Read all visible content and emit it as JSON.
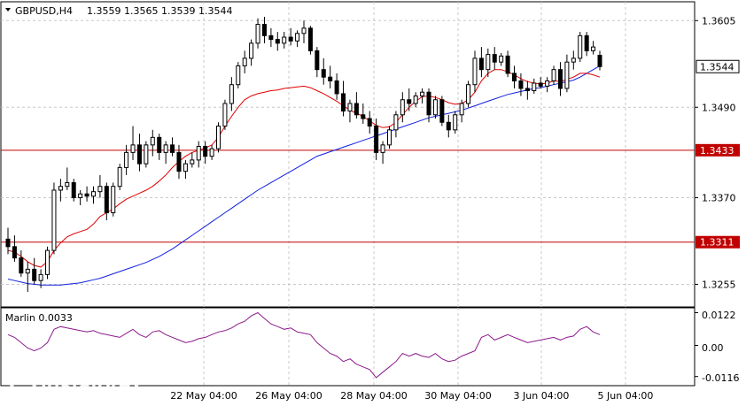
{
  "header": {
    "symbol": "GBPUSD,H4",
    "ohlc": "1.3559 1.3565 1.3539 1.3544"
  },
  "indicator": {
    "label": "Marlin 0.0033",
    "ticks": [
      "0.0122",
      "0.00",
      "-0.0116"
    ]
  },
  "watermark": {
    "brand": "instaforex",
    "tagline": "Instant Forex Trading"
  },
  "colors": {
    "background": "#ffffff",
    "grid": "#c8c8c8",
    "level": "#c00000",
    "ma_fast": "#e00000",
    "ma_slow": "#1020e0",
    "marlin": "#8b1a8b",
    "candle": "#000000",
    "current_box": "#000000"
  },
  "chart_data": {
    "type": "candlestick",
    "timeframe": "H4",
    "price_ticks": [
      "1.3605",
      "1.3490",
      "1.3370",
      "1.3255"
    ],
    "x_ticks": [
      "22 May 04:00",
      "26 May 04:00",
      "28 May 04:00",
      "30 May 04:00",
      "3 Jun 04:00",
      "5 Jun 04:00"
    ],
    "ylim": [
      1.3225,
      1.363
    ],
    "levels": [
      {
        "value": 1.3433,
        "label": "1.3433"
      },
      {
        "value": 1.3311,
        "label": "1.3311"
      }
    ],
    "current_price": {
      "value": 1.3544,
      "label": "1.3544"
    },
    "candles": [
      [
        1.3315,
        1.333,
        1.3295,
        1.3305
      ],
      [
        1.3305,
        1.332,
        1.3285,
        1.329
      ],
      [
        1.329,
        1.33,
        1.3265,
        1.327
      ],
      [
        1.327,
        1.3285,
        1.3245,
        1.3275
      ],
      [
        1.3275,
        1.329,
        1.3255,
        1.326
      ],
      [
        1.326,
        1.3275,
        1.325,
        1.3268
      ],
      [
        1.3268,
        1.3305,
        1.3262,
        1.33
      ],
      [
        1.33,
        1.339,
        1.3295,
        1.338
      ],
      [
        1.338,
        1.3395,
        1.3365,
        1.3385
      ],
      [
        1.3385,
        1.341,
        1.338,
        1.339
      ],
      [
        1.339,
        1.3395,
        1.3365,
        1.337
      ],
      [
        1.337,
        1.338,
        1.336,
        1.3375
      ],
      [
        1.3375,
        1.3385,
        1.3365,
        1.3372
      ],
      [
        1.3372,
        1.3385,
        1.3362,
        1.3378
      ],
      [
        1.3378,
        1.34,
        1.337,
        1.3385
      ],
      [
        1.3385,
        1.339,
        1.334,
        1.335
      ],
      [
        1.335,
        1.339,
        1.3345,
        1.3385
      ],
      [
        1.3385,
        1.3415,
        1.338,
        1.341
      ],
      [
        1.341,
        1.344,
        1.34,
        1.343
      ],
      [
        1.343,
        1.3465,
        1.342,
        1.344
      ],
      [
        1.344,
        1.3455,
        1.3405,
        1.3415
      ],
      [
        1.3415,
        1.3445,
        1.341,
        1.344
      ],
      [
        1.344,
        1.346,
        1.3425,
        1.345
      ],
      [
        1.345,
        1.3455,
        1.342,
        1.343
      ],
      [
        1.343,
        1.3445,
        1.3415,
        1.344
      ],
      [
        1.344,
        1.345,
        1.3425,
        1.343
      ],
      [
        1.343,
        1.344,
        1.3395,
        1.3405
      ],
      [
        1.3405,
        1.342,
        1.3395,
        1.3415
      ],
      [
        1.3415,
        1.343,
        1.341,
        1.342
      ],
      [
        1.342,
        1.3445,
        1.341,
        1.3438
      ],
      [
        1.3438,
        1.3445,
        1.3415,
        1.3425
      ],
      [
        1.3425,
        1.344,
        1.342,
        1.3435
      ],
      [
        1.3435,
        1.347,
        1.343,
        1.3465
      ],
      [
        1.3465,
        1.35,
        1.346,
        1.3495
      ],
      [
        1.3495,
        1.353,
        1.3485,
        1.352
      ],
      [
        1.352,
        1.355,
        1.3515,
        1.3545
      ],
      [
        1.3545,
        1.3565,
        1.3535,
        1.3555
      ],
      [
        1.3555,
        1.358,
        1.3545,
        1.3575
      ],
      [
        1.3575,
        1.3608,
        1.3568,
        1.36
      ],
      [
        1.36,
        1.361,
        1.3575,
        1.3585
      ],
      [
        1.3585,
        1.3595,
        1.357,
        1.358
      ],
      [
        1.358,
        1.359,
        1.3565,
        1.3575
      ],
      [
        1.3575,
        1.359,
        1.3568,
        1.3583
      ],
      [
        1.3583,
        1.3595,
        1.3572,
        1.3578
      ],
      [
        1.3578,
        1.3592,
        1.357,
        1.3588
      ],
      [
        1.3588,
        1.3605,
        1.3575,
        1.3595
      ],
      [
        1.3595,
        1.3598,
        1.356,
        1.3565
      ],
      [
        1.3565,
        1.357,
        1.353,
        1.354
      ],
      [
        1.354,
        1.3555,
        1.352,
        1.353
      ],
      [
        1.353,
        1.3545,
        1.3515,
        1.3525
      ],
      [
        1.3525,
        1.3535,
        1.35,
        1.3508
      ],
      [
        1.3508,
        1.3525,
        1.3478,
        1.3485
      ],
      [
        1.3485,
        1.35,
        1.347,
        1.3495
      ],
      [
        1.3495,
        1.351,
        1.3475,
        1.348
      ],
      [
        1.348,
        1.3495,
        1.3468,
        1.3475
      ],
      [
        1.3475,
        1.3485,
        1.3455,
        1.3465
      ],
      [
        1.3465,
        1.3475,
        1.342,
        1.343
      ],
      [
        1.343,
        1.3445,
        1.3415,
        1.344
      ],
      [
        1.344,
        1.3465,
        1.3435,
        1.346
      ],
      [
        1.346,
        1.3485,
        1.345,
        1.348
      ],
      [
        1.348,
        1.351,
        1.347,
        1.35
      ],
      [
        1.35,
        1.3515,
        1.3485,
        1.3495
      ],
      [
        1.3495,
        1.351,
        1.349,
        1.3505
      ],
      [
        1.3505,
        1.3515,
        1.3495,
        1.351
      ],
      [
        1.351,
        1.3515,
        1.347,
        1.348
      ],
      [
        1.348,
        1.3505,
        1.3475,
        1.35
      ],
      [
        1.35,
        1.3505,
        1.3465,
        1.347
      ],
      [
        1.347,
        1.348,
        1.345,
        1.346
      ],
      [
        1.346,
        1.3485,
        1.3455,
        1.348
      ],
      [
        1.348,
        1.35,
        1.347,
        1.3495
      ],
      [
        1.3495,
        1.3525,
        1.349,
        1.352
      ],
      [
        1.352,
        1.3565,
        1.351,
        1.3555
      ],
      [
        1.3555,
        1.357,
        1.353,
        1.354
      ],
      [
        1.354,
        1.3568,
        1.353,
        1.356
      ],
      [
        1.356,
        1.357,
        1.354,
        1.355
      ],
      [
        1.355,
        1.3562,
        1.3545,
        1.3558
      ],
      [
        1.3558,
        1.3565,
        1.353,
        1.3535
      ],
      [
        1.3535,
        1.3545,
        1.3515,
        1.3525
      ],
      [
        1.3525,
        1.3535,
        1.3505,
        1.3515
      ],
      [
        1.3515,
        1.3525,
        1.35,
        1.3512
      ],
      [
        1.3512,
        1.3528,
        1.3508,
        1.3522
      ],
      [
        1.3522,
        1.353,
        1.3515,
        1.3518
      ],
      [
        1.3518,
        1.353,
        1.351,
        1.3525
      ],
      [
        1.3525,
        1.3545,
        1.352,
        1.354
      ],
      [
        1.354,
        1.355,
        1.3505,
        1.3515
      ],
      [
        1.3515,
        1.356,
        1.351,
        1.355
      ],
      [
        1.355,
        1.3565,
        1.354,
        1.3555
      ],
      [
        1.3555,
        1.359,
        1.355,
        1.3585
      ],
      [
        1.3585,
        1.359,
        1.3558,
        1.3565
      ],
      [
        1.3565,
        1.3578,
        1.356,
        1.357
      ],
      [
        1.3559,
        1.3565,
        1.3539,
        1.3544
      ]
    ],
    "ma_fast": [
      1.33,
      1.3298,
      1.3292,
      1.3285,
      1.328,
      1.3278,
      1.3285,
      1.33,
      1.331,
      1.3318,
      1.3322,
      1.3325,
      1.3328,
      1.3335,
      1.3345,
      1.335,
      1.3355,
      1.3362,
      1.3368,
      1.3372,
      1.3376,
      1.338,
      1.3385,
      1.3392,
      1.34,
      1.341,
      1.3418,
      1.3425,
      1.343,
      1.3433,
      1.3436,
      1.344,
      1.345,
      1.3465,
      1.3478,
      1.349,
      1.35,
      1.3505,
      1.3508,
      1.351,
      1.3512,
      1.3513,
      1.3515,
      1.3516,
      1.3517,
      1.3518,
      1.3516,
      1.3512,
      1.3508,
      1.3503,
      1.3498,
      1.3492,
      1.3486,
      1.3482,
      1.3478,
      1.3472,
      1.3466,
      1.3463,
      1.3464,
      1.347,
      1.348,
      1.349,
      1.3498,
      1.3504,
      1.3505,
      1.3503,
      1.35,
      1.3496,
      1.3494,
      1.3495,
      1.35,
      1.351,
      1.3525,
      1.3535,
      1.354,
      1.354,
      1.3537,
      1.3533,
      1.3528,
      1.3524,
      1.3522,
      1.3521,
      1.3522,
      1.3525,
      1.3524,
      1.3527,
      1.353,
      1.3535,
      1.3535,
      1.3533,
      1.353
    ],
    "ma_slow": [
      1.3262,
      1.326,
      1.3258,
      1.3256,
      1.3255,
      1.3254,
      1.3254,
      1.3254,
      1.3254,
      1.3255,
      1.3256,
      1.3257,
      1.3259,
      1.3261,
      1.3263,
      1.3266,
      1.3269,
      1.3272,
      1.3275,
      1.3278,
      1.3281,
      1.3284,
      1.3288,
      1.3292,
      1.3297,
      1.3302,
      1.3308,
      1.3314,
      1.332,
      1.3326,
      1.3332,
      1.3338,
      1.3344,
      1.335,
      1.3356,
      1.3362,
      1.3368,
      1.3374,
      1.338,
      1.3385,
      1.339,
      1.3395,
      1.34,
      1.3405,
      1.341,
      1.3415,
      1.342,
      1.3425,
      1.3428,
      1.3431,
      1.3434,
      1.3437,
      1.344,
      1.3443,
      1.3446,
      1.3449,
      1.3452,
      1.3455,
      1.3458,
      1.3461,
      1.3464,
      1.3467,
      1.347,
      1.3473,
      1.3476,
      1.3478,
      1.348,
      1.3482,
      1.3484,
      1.3486,
      1.3489,
      1.3492,
      1.3495,
      1.3498,
      1.3501,
      1.3504,
      1.3507,
      1.3509,
      1.3511,
      1.3513,
      1.3515,
      1.3516,
      1.3518,
      1.352,
      1.3522,
      1.3524,
      1.3526,
      1.353,
      1.3535,
      1.354,
      1.3545
    ],
    "marlin": {
      "ylim": [
        -0.015,
        0.014
      ],
      "values": [
        0.004,
        0.003,
        0.001,
        -0.001,
        -0.002,
        -0.001,
        0.001,
        0.006,
        0.007,
        0.0065,
        0.006,
        0.0055,
        0.005,
        0.0055,
        0.0045,
        0.004,
        0.0035,
        0.003,
        0.0045,
        0.006,
        0.004,
        0.003,
        0.005,
        0.0055,
        0.004,
        0.003,
        0.002,
        0.001,
        0.0015,
        0.0025,
        0.003,
        0.004,
        0.005,
        0.0055,
        0.0065,
        0.008,
        0.009,
        0.011,
        0.0122,
        0.01,
        0.008,
        0.007,
        0.006,
        0.0065,
        0.005,
        0.0045,
        0.004,
        0.001,
        -0.001,
        -0.003,
        -0.004,
        -0.006,
        -0.005,
        -0.007,
        -0.008,
        -0.009,
        -0.012,
        -0.01,
        -0.008,
        -0.006,
        -0.003,
        -0.004,
        -0.003,
        -0.004,
        -0.0045,
        -0.003,
        -0.005,
        -0.006,
        -0.0055,
        -0.004,
        -0.003,
        -0.002,
        0.003,
        0.004,
        0.002,
        0.003,
        0.004,
        0.003,
        0.002,
        0.001,
        0.0015,
        0.002,
        0.0025,
        0.003,
        0.002,
        0.003,
        0.0035,
        0.006,
        0.007,
        0.005,
        0.004
      ]
    }
  }
}
